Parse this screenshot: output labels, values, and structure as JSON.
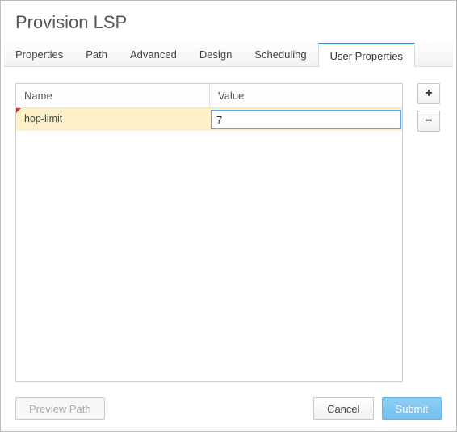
{
  "dialog": {
    "title": "Provision LSP"
  },
  "tabs": {
    "properties": "Properties",
    "path": "Path",
    "advanced": "Advanced",
    "design": "Design",
    "scheduling": "Scheduling",
    "user_properties": "User Properties"
  },
  "table": {
    "headers": {
      "name": "Name",
      "value": "Value"
    },
    "rows": [
      {
        "name": "hop-limit",
        "value": "7"
      }
    ]
  },
  "side": {
    "add": "+",
    "remove": "−"
  },
  "footer": {
    "preview_path": "Preview Path",
    "cancel": "Cancel",
    "submit": "Submit"
  }
}
